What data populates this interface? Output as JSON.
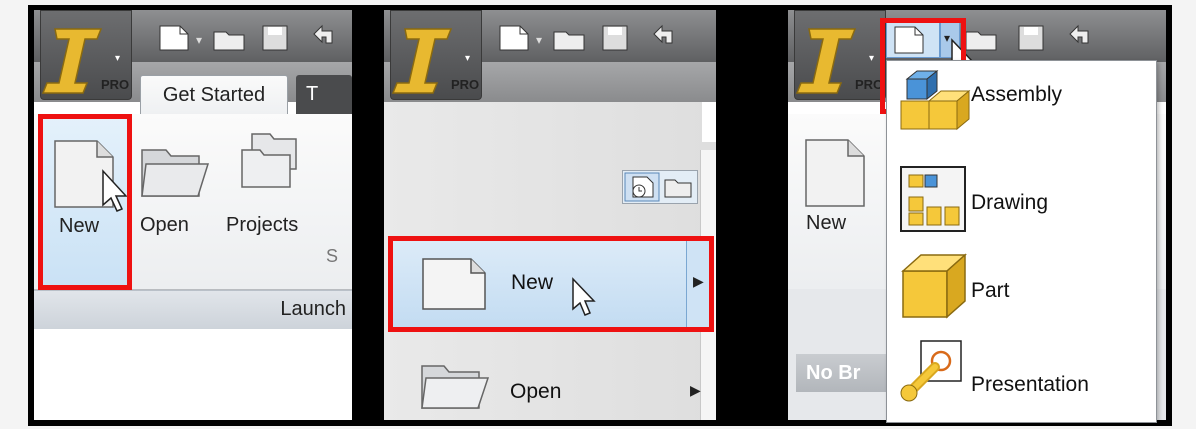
{
  "panel1": {
    "logo_badge": "PRO",
    "tab_label": "Get Started",
    "tab_next_partial": "T",
    "buttons": [
      {
        "label": "New"
      },
      {
        "label": "Open"
      },
      {
        "label": "Projects"
      }
    ],
    "group_partial": "S",
    "group_label": "Launch"
  },
  "panel2": {
    "logo_badge": "PRO",
    "new_label": "New",
    "open_label": "Open"
  },
  "panel3": {
    "logo_badge": "PRO",
    "new_label": "New",
    "browser_partial": "No Br",
    "dropdown": [
      {
        "label": "Assembly",
        "icon": "assembly-icon"
      },
      {
        "label": "Drawing",
        "icon": "drawing-icon"
      },
      {
        "label": "Part",
        "icon": "part-icon"
      },
      {
        "label": "Presentation",
        "icon": "presentation-icon"
      }
    ]
  },
  "colors": {
    "highlight": "#ee1111",
    "selection": "#cfe3f5",
    "frame": "#000000"
  }
}
